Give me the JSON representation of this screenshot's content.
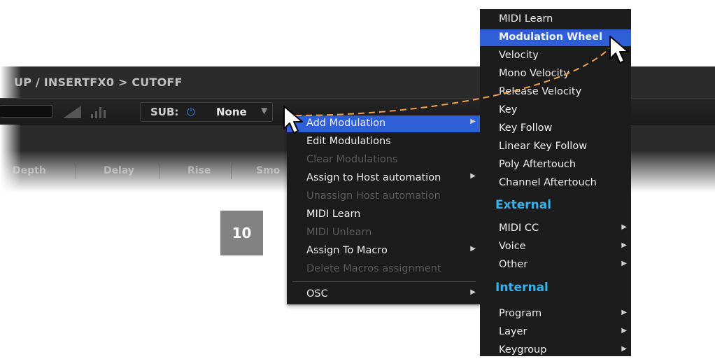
{
  "breadcrumb": "UP / INSERTFX0 > CUTOFF",
  "sub": {
    "label": "SUB:",
    "value": "None"
  },
  "columns": [
    "Depth",
    "Delay",
    "Rise",
    "Smo"
  ],
  "badge": "10",
  "context_menu": {
    "items": [
      {
        "label": "Add Modulation",
        "enabled": true,
        "submenu": true,
        "highlighted": true
      },
      {
        "label": "Edit Modulations",
        "enabled": true,
        "submenu": false
      },
      {
        "label": "Clear Modulations",
        "enabled": false,
        "submenu": false
      },
      {
        "label": "Assign to Host automation",
        "enabled": true,
        "submenu": true
      },
      {
        "label": "Unassign Host automation",
        "enabled": false,
        "submenu": false
      },
      {
        "label": "MIDI Learn",
        "enabled": true,
        "submenu": false
      },
      {
        "label": "MIDI Unlearn",
        "enabled": false,
        "submenu": false
      },
      {
        "label": "Assign To Macro",
        "enabled": true,
        "submenu": true
      },
      {
        "label": "Delete Macros assignment",
        "enabled": false,
        "submenu": false
      },
      {
        "label": "OSC",
        "enabled": true,
        "submenu": true
      }
    ]
  },
  "submenu": {
    "items": [
      {
        "label": "MIDI Learn"
      },
      {
        "label": "Modulation Wheel",
        "highlighted": true
      },
      {
        "label": "Velocity"
      },
      {
        "label": "Mono Velocity"
      },
      {
        "label": "Release Velocity"
      },
      {
        "label": "Key"
      },
      {
        "label": "Key Follow"
      },
      {
        "label": "Linear Key Follow"
      },
      {
        "label": "Poly Aftertouch"
      },
      {
        "label": "Channel Aftertouch"
      }
    ],
    "external_header": "External",
    "external_items": [
      {
        "label": "MIDI CC",
        "submenu": true
      },
      {
        "label": "Voice",
        "submenu": true
      },
      {
        "label": "Other",
        "submenu": true
      }
    ],
    "internal_header": "Internal",
    "internal_items": [
      {
        "label": "Program",
        "submenu": true
      },
      {
        "label": "Layer",
        "submenu": true
      },
      {
        "label": "Keygroup",
        "submenu": true
      }
    ]
  },
  "colors": {
    "highlight": "#2f5fd6",
    "section_header": "#3ab0e8",
    "curve": "#f0a050"
  }
}
